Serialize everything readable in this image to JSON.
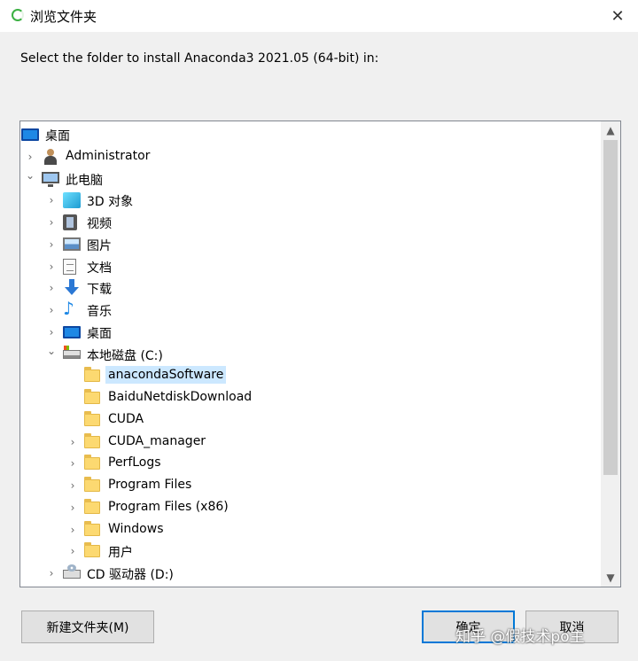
{
  "window": {
    "title": "浏览文件夹",
    "close_glyph": "✕"
  },
  "instruction": "Select the folder to install Anaconda3 2021.05 (64-bit) in:",
  "tree": [
    {
      "label": "桌面",
      "icon": "desktop-icon",
      "chevron": "",
      "depth": 0
    },
    {
      "label": "Administrator",
      "icon": "user-icon",
      "chevron": "›",
      "depth": 1
    },
    {
      "label": "此电脑",
      "icon": "computer-icon",
      "chevron": "⌄",
      "depth": 1
    },
    {
      "label": "3D 对象",
      "icon": "3d-objects-icon",
      "chevron": "›",
      "depth": 2
    },
    {
      "label": "视频",
      "icon": "video-icon",
      "chevron": "›",
      "depth": 2
    },
    {
      "label": "图片",
      "icon": "picture-icon",
      "chevron": "›",
      "depth": 2
    },
    {
      "label": "文档",
      "icon": "document-icon",
      "chevron": "›",
      "depth": 2
    },
    {
      "label": "下载",
      "icon": "download-icon",
      "chevron": "›",
      "depth": 2
    },
    {
      "label": "音乐",
      "icon": "music-icon",
      "chevron": "›",
      "depth": 2
    },
    {
      "label": "桌面",
      "icon": "desktop-icon",
      "chevron": "›",
      "depth": 2
    },
    {
      "label": "本地磁盘 (C:)",
      "icon": "drive-icon",
      "chevron": "⌄",
      "depth": 2
    },
    {
      "label": "anacondaSoftware",
      "icon": "folder-icon",
      "chevron": "",
      "depth": 3,
      "selected": true
    },
    {
      "label": "BaiduNetdiskDownload",
      "icon": "folder-icon",
      "chevron": "",
      "depth": 3
    },
    {
      "label": "CUDA",
      "icon": "folder-icon",
      "chevron": "",
      "depth": 3
    },
    {
      "label": "CUDA_manager",
      "icon": "folder-icon",
      "chevron": "›",
      "depth": 3
    },
    {
      "label": "PerfLogs",
      "icon": "folder-icon",
      "chevron": "›",
      "depth": 3
    },
    {
      "label": "Program Files",
      "icon": "folder-icon",
      "chevron": "›",
      "depth": 3
    },
    {
      "label": "Program Files (x86)",
      "icon": "folder-icon",
      "chevron": "›",
      "depth": 3
    },
    {
      "label": "Windows",
      "icon": "folder-icon",
      "chevron": "›",
      "depth": 3
    },
    {
      "label": "用户",
      "icon": "folder-icon",
      "chevron": "›",
      "depth": 3
    },
    {
      "label": "CD 驱动器 (D:)",
      "icon": "cd-drive-icon",
      "chevron": "›",
      "depth": 2
    }
  ],
  "scrollbar": {
    "up": "▲",
    "down": "▼"
  },
  "buttons": {
    "new_folder": "新建文件夹(M)",
    "ok": "确定",
    "cancel": "取消"
  },
  "watermark": "知乎 @假技术po主"
}
